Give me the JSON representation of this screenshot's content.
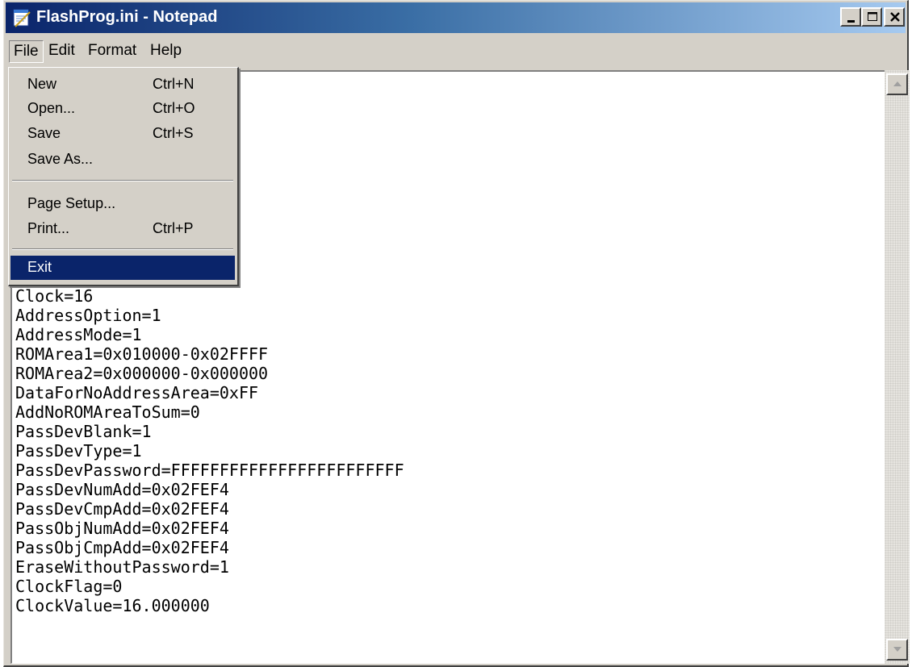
{
  "window": {
    "title": "FlashProg.ini - Notepad",
    "controls": [
      "minimize-icon",
      "maximize-icon",
      "close-icon"
    ]
  },
  "menubar": {
    "items": [
      {
        "label": "File",
        "active": true
      },
      {
        "label": "Edit"
      },
      {
        "label": "Format"
      },
      {
        "label": "Help"
      }
    ]
  },
  "file_menu": {
    "items": [
      {
        "label": "New",
        "shortcut": "Ctrl+N"
      },
      {
        "label": "Open...",
        "shortcut": "Ctrl+O"
      },
      {
        "label": "Save",
        "shortcut": "Ctrl+S"
      },
      {
        "label": "Save As...",
        "shortcut": ""
      },
      {
        "label": "Page Setup...",
        "shortcut": ""
      },
      {
        "label": "Print...",
        "shortcut": "Ctrl+P"
      },
      {
        "label": "Exit",
        "shortcut": "",
        "selected": true
      }
    ]
  },
  "editor": {
    "content": "\n\n\n\n\n\n\n\n\n\n\nClock=16\nAddressOption=1\nAddressMode=1\nROMArea1=0x010000-0x02FFFF\nROMArea2=0x000000-0x000000\nDataForNoAddressArea=0xFF\nAddNoROMAreaToSum=0\nPassDevBlank=1\nPassDevType=1\nPassDevPassword=FFFFFFFFFFFFFFFFFFFFFFFF\nPassDevNumAdd=0x02FEF4\nPassDevCmpAdd=0x02FEF4\nPassObjNumAdd=0x02FEF4\nPassObjCmpAdd=0x02FEF4\nEraseWithoutPassword=1\nClockFlag=0\nClockValue=16.000000"
  },
  "colors": {
    "titlebar_start": "#0a246a",
    "titlebar_end": "#a6caf0",
    "chrome": "#d4d0c8",
    "selection": "#0a246a"
  }
}
